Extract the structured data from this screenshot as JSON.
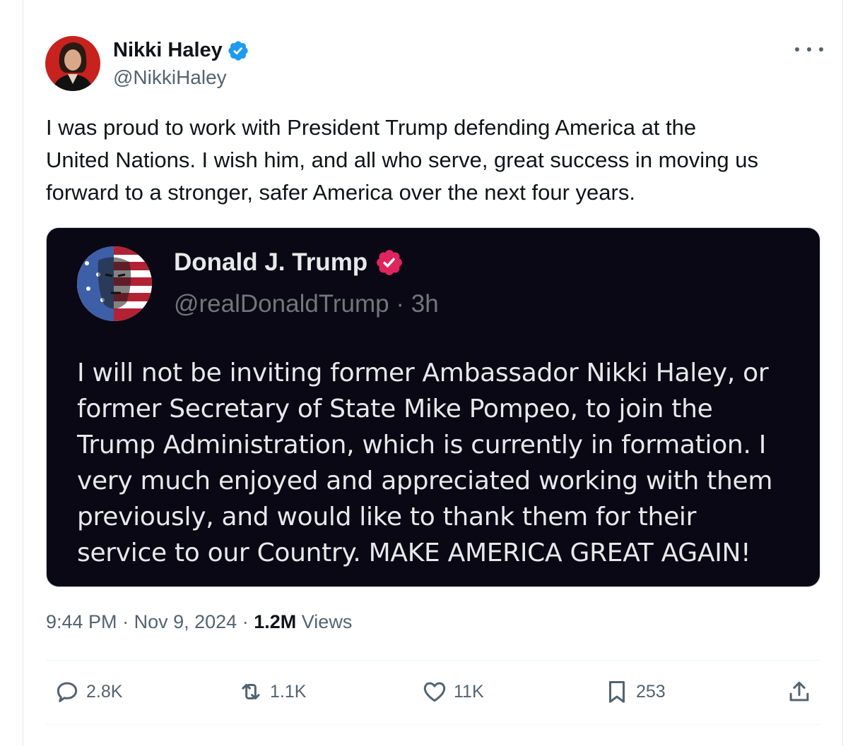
{
  "author": {
    "name": "Nikki Haley",
    "handle": "@NikkiHaley",
    "verified_icon": "blue-check-icon"
  },
  "tweet": {
    "lines": [
      "I was proud to work with President Trump defending America at the",
      "United Nations. I wish him, and all who serve, great success in moving us",
      "forward to a stronger, safer America over the next four years."
    ]
  },
  "quote": {
    "name": "Donald J. Trump",
    "handle": "@realDonaldTrump",
    "separator": "·",
    "age": "3h",
    "verified_icon": "pink-check-icon",
    "lines": [
      "I will not be inviting former Ambassador Nikki Haley, or",
      "former Secretary of State Mike Pompeo, to join the",
      "Trump Administration, which is currently in formation. I",
      "very much enjoyed and appreciated working with them",
      "previously, and would like to thank them for their",
      "service to our Country. MAKE AMERICA GREAT AGAIN!"
    ]
  },
  "meta": {
    "time": "9:44 PM",
    "sep1": "·",
    "date": "Nov 9, 2024",
    "sep2": "·",
    "views_count": "1.2M",
    "views_label": "Views"
  },
  "actions": {
    "replies": "2.8K",
    "reposts": "1.1K",
    "likes": "11K",
    "bookmarks": "253"
  },
  "colors": {
    "text": "#0f1419",
    "secondary": "#536471",
    "verified_blue": "#1d9bf0",
    "quote_bg": "#0a0814",
    "verified_pink": "#e0245e"
  }
}
